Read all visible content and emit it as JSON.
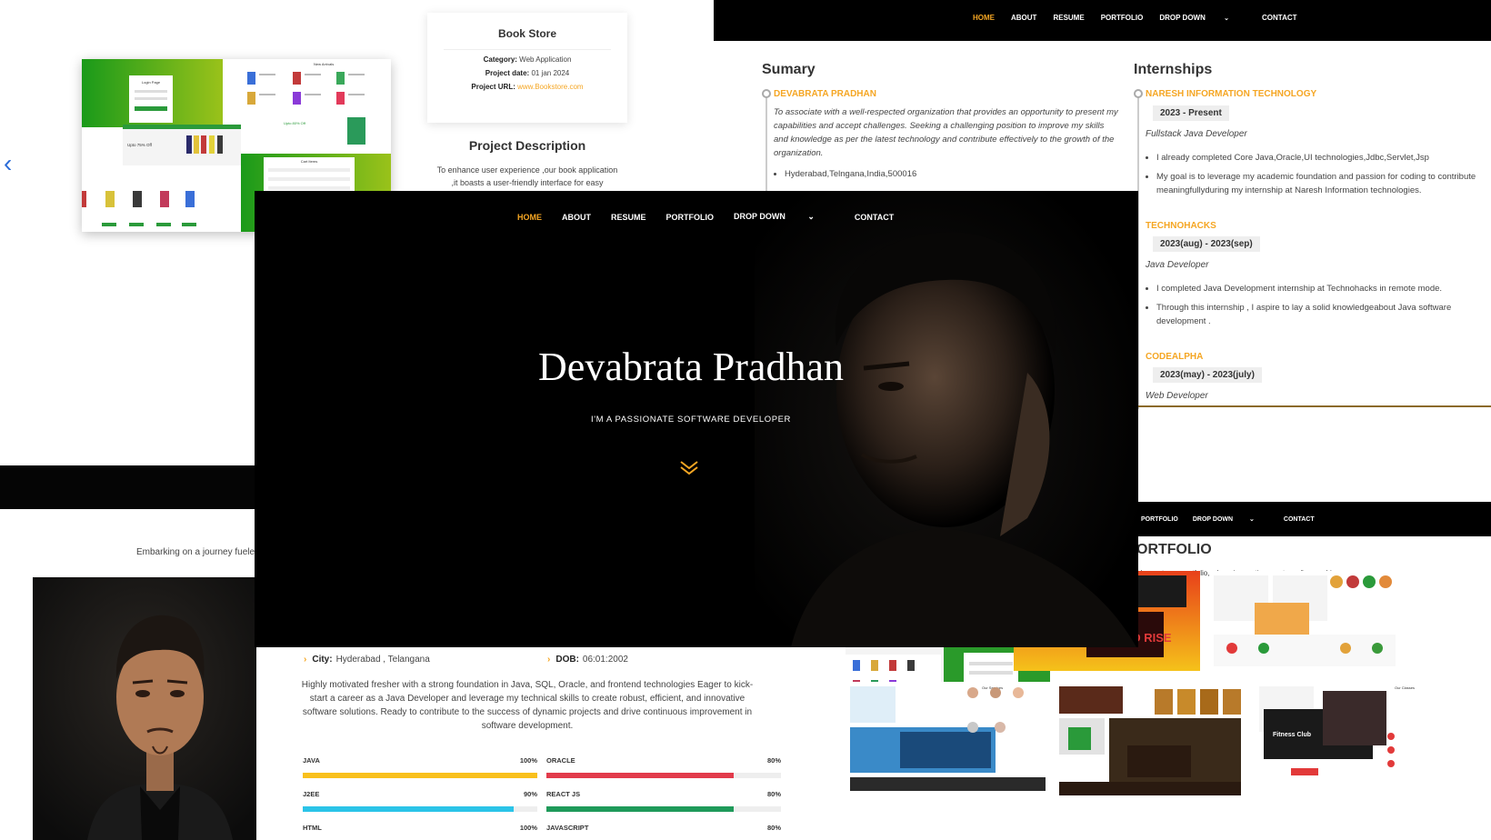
{
  "bookstore": {
    "card_title": "Book Store",
    "category_label": "Category:",
    "category_value": "Web Application",
    "date_label": "Project date:",
    "date_value": "01 jan 2024",
    "url_label": "Project URL:",
    "url_value": "www.Bookstore.com",
    "desc_title": "Project Description",
    "desc_text_1": "To enhance user experience ,our book application",
    "desc_text_2": ",it boasts a user-friendly interface for easy",
    "shot_login_title": "Login Page",
    "shot_arrivals": "New Arrivals",
    "shot_offer": "Upto 75% Off",
    "shot_offer2": "Upto 80% Off",
    "shot_cart": "Cart Items",
    "prev_icon": "chevron-left-icon"
  },
  "resume": {
    "nav": [
      "HOME",
      "ABOUT",
      "RESUME",
      "PORTFOLIO",
      "DROP DOWN",
      "CONTACT"
    ],
    "summary_heading": "Sumary",
    "summary_name": "DEVABRATA PRADHAN",
    "summary_text": "To associate with a well-respected organization that provides an opportunity to present my capabilities and accept challenges. Seeking a challenging position to improve my skills and knowledge as per the latest technology and contribute effectively to the growth of the organization.",
    "summary_address": "Hyderabad,Telngana,India,500016",
    "internships_heading": "Internships",
    "internships": [
      {
        "org": "NARESH INFORMATION TECHNOLOGY",
        "period": "2023 - Present",
        "role": "Fullstack Java Developer",
        "points": [
          "I already completed Core Java,Oracle,UI technologies,Jdbc,Servlet,Jsp",
          "My goal is to leverage my academic foundation and passion for coding to contribute meaningfullyduring my internship at Naresh Information technologies."
        ]
      },
      {
        "org": "TECHNOHACKS",
        "period": "2023(aug) - 2023(sep)",
        "role": "Java Developer",
        "points": [
          "I completed Java Development internship at Technohacks in remote mode.",
          "Through this internship , I aspire to lay a solid knowledgeabout Java software development ."
        ]
      },
      {
        "org": "CODEALPHA",
        "period": "2023(may) - 2023(july)",
        "role": "Web Developer",
        "points": []
      }
    ]
  },
  "hero": {
    "nav": [
      "HOME",
      "ABOUT",
      "RESUME",
      "PORTFOLIO",
      "DROP DOWN",
      "CONTACT"
    ],
    "name": "Devabrata Pradhan",
    "tagline": "I'M A PASSIONATE SOFTWARE DEVELOPER",
    "scroll_icon": "double-chevron-down-icon",
    "accent": "#f5a623"
  },
  "portfolio": {
    "nav": [
      "PORTFOLIO",
      "DROP DOWN",
      "CONTACT"
    ],
    "title": "ORTFOLIO",
    "subtitle": "elcome to my portfolio, where innovation meets craftsmanship.",
    "thumb_labels": {
      "movie": "EVIL DEAD RISE",
      "fitness": "Fitness Club",
      "classes": "Our Classes",
      "services": "Our Services"
    }
  },
  "about": {
    "city_label": "City:",
    "city_value": "Hyderabad , Telangana",
    "dob_label": "DOB:",
    "dob_value": "06:01:2002",
    "text": "Highly motivated fresher with a strong foundation in Java, SQL, Oracle, and frontend technologies Eager to kick-start a career as a Java Developer and leverage my technical skills to create robust, efficient, and innovative software solutions. Ready to contribute to the success of dynamic projects and drive continuous improvement in software development.",
    "skills": [
      {
        "name": "JAVA",
        "pct": "100%",
        "level": 1.0,
        "color": "#f9c01c"
      },
      {
        "name": "ORACLE",
        "pct": "80%",
        "level": 0.8,
        "color": "#e23b4b"
      },
      {
        "name": "J2EE",
        "pct": "90%",
        "level": 0.9,
        "color": "#2bc4e8"
      },
      {
        "name": "REACT JS",
        "pct": "80%",
        "level": 0.8,
        "color": "#1f9a5a"
      },
      {
        "name": "HTML",
        "pct": "100%",
        "level": 1.0,
        "color": "#f5a623"
      },
      {
        "name": "JAVASCRIPT",
        "pct": "80%",
        "level": 0.8,
        "color": "#2b6cd8"
      }
    ]
  },
  "embark_text": "Embarking on a journey fuele"
}
